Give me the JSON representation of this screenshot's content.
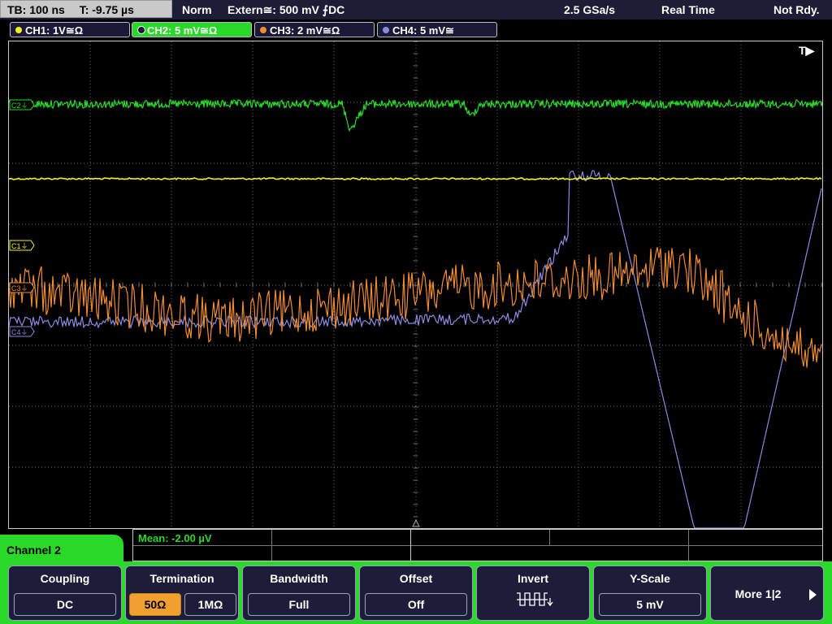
{
  "topbar": {
    "timebase": "TB: 100 ns",
    "trigger_pos": "T: -9.75 µs",
    "mode": "Norm",
    "trigger": "Extern≅: 500 mV ⨍DC",
    "sample_rate": "2.5 GSa/s",
    "acq_mode": "Real Time",
    "status": "Not Rdy."
  },
  "channels": [
    {
      "label": "CH1: 1V≅Ω",
      "color": "#f2f21e",
      "active": false
    },
    {
      "label": "CH2: 5 mV≅Ω",
      "color": "#29d829",
      "active": true
    },
    {
      "label": "CH3: 2 mV≅Ω",
      "color": "#f08c32",
      "active": false
    },
    {
      "label": "CH4: 5 mV≅",
      "color": "#8a8ae0",
      "active": false
    }
  ],
  "markers": {
    "ch1": "C1⏚",
    "ch2": "C2⏚",
    "ch3": "C3⏚",
    "ch4": "C4⏚",
    "trigger": "T▶"
  },
  "measurement": {
    "label": "Mean: -2.00 µV"
  },
  "menu": {
    "title": "Channel 2",
    "coupling": {
      "title": "Coupling",
      "value": "DC"
    },
    "termination": {
      "title": "Termination",
      "opt1": "50Ω",
      "opt2": "1MΩ",
      "selected": "50Ω"
    },
    "bandwidth": {
      "title": "Bandwidth",
      "value": "Full"
    },
    "offset": {
      "title": "Offset",
      "value": "Off"
    },
    "invert": {
      "title": "Invert",
      "icon": "invert-square-wave-icon"
    },
    "yscale": {
      "title": "Y-Scale",
      "value": "5 mV"
    },
    "more": {
      "label": "More 1|2"
    }
  },
  "colors": {
    "ch1": "#f2f21e",
    "ch2": "#29d829",
    "ch3": "#f08c32",
    "ch4": "#8a8ae0",
    "grid": "#6a6a6a"
  }
}
